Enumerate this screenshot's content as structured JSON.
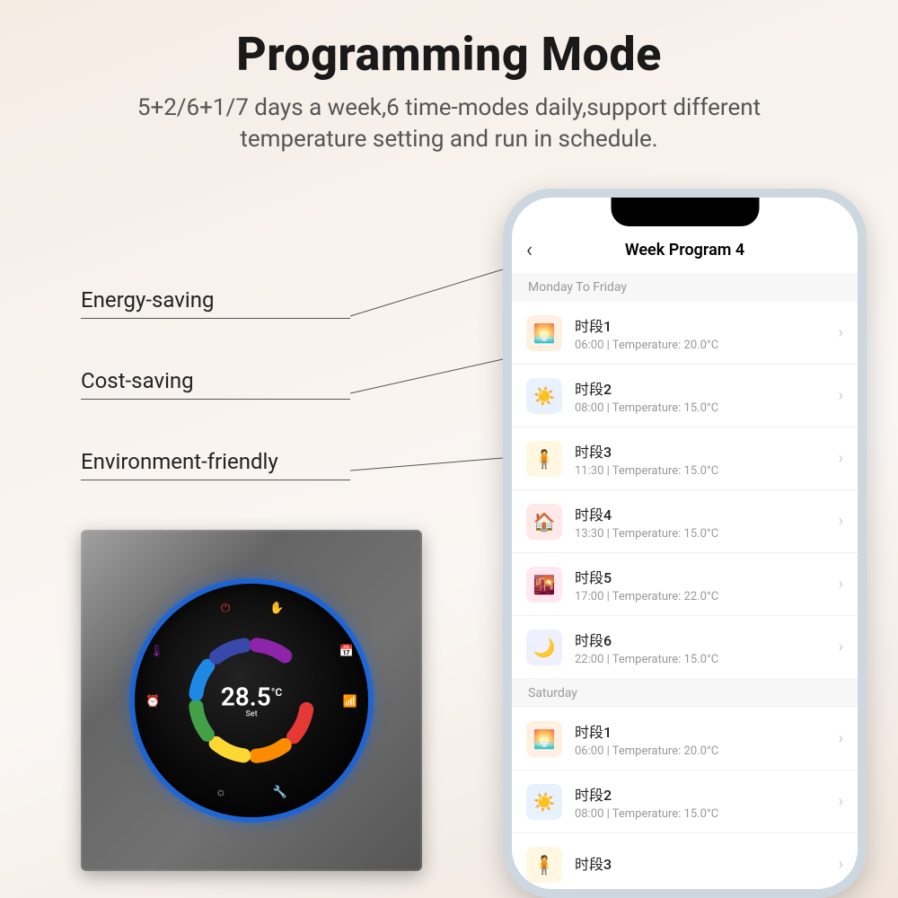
{
  "header": {
    "title": "Programming Mode",
    "subtitle": "5+2/6+1/7 days a week,6 time-modes daily,support different temperature setting and run in schedule."
  },
  "callouts": [
    "Energy-saving",
    "Cost-saving",
    "Environment-friendly"
  ],
  "device": {
    "temperature": "28.5",
    "unit": "°C",
    "sub_label": "Set"
  },
  "phone": {
    "screen_title": "Week Program 4",
    "sections": [
      {
        "header": "Monday To Friday",
        "items": [
          {
            "icon": "sunrise-icon",
            "icon_glyph": "🌅",
            "icon_bg": "#fff0e0",
            "title": "时段1",
            "time": "06:00",
            "temp": "Temperature: 20.0°C"
          },
          {
            "icon": "sun-icon",
            "icon_glyph": "☀️",
            "icon_bg": "#e8f2ff",
            "title": "时段2",
            "time": "08:00",
            "temp": "Temperature: 15.0°C"
          },
          {
            "icon": "person-icon",
            "icon_glyph": "🧍",
            "icon_bg": "#fff7e0",
            "title": "时段3",
            "time": "11:30",
            "temp": "Temperature: 15.0°C"
          },
          {
            "icon": "home-icon",
            "icon_glyph": "🏠",
            "icon_bg": "#ffe8e8",
            "title": "时段4",
            "time": "13:30",
            "temp": "Temperature: 15.0°C"
          },
          {
            "icon": "sunset-icon",
            "icon_glyph": "🌇",
            "icon_bg": "#ffe8f2",
            "title": "时段5",
            "time": "17:00",
            "temp": "Temperature: 22.0°C"
          },
          {
            "icon": "moon-icon",
            "icon_glyph": "🌙",
            "icon_bg": "#eef0ff",
            "title": "时段6",
            "time": "22:00",
            "temp": "Temperature: 15.0°C"
          }
        ]
      },
      {
        "header": "Saturday",
        "items": [
          {
            "icon": "sunrise-icon",
            "icon_glyph": "🌅",
            "icon_bg": "#fff0e0",
            "title": "时段1",
            "time": "06:00",
            "temp": "Temperature: 20.0°C"
          },
          {
            "icon": "sun-icon",
            "icon_glyph": "☀️",
            "icon_bg": "#e8f2ff",
            "title": "时段2",
            "time": "08:00",
            "temp": "Temperature: 15.0°C"
          },
          {
            "icon": "person-icon",
            "icon_glyph": "🧍",
            "icon_bg": "#fff7e0",
            "title": "时段3",
            "time": "",
            "temp": ""
          }
        ]
      }
    ]
  }
}
